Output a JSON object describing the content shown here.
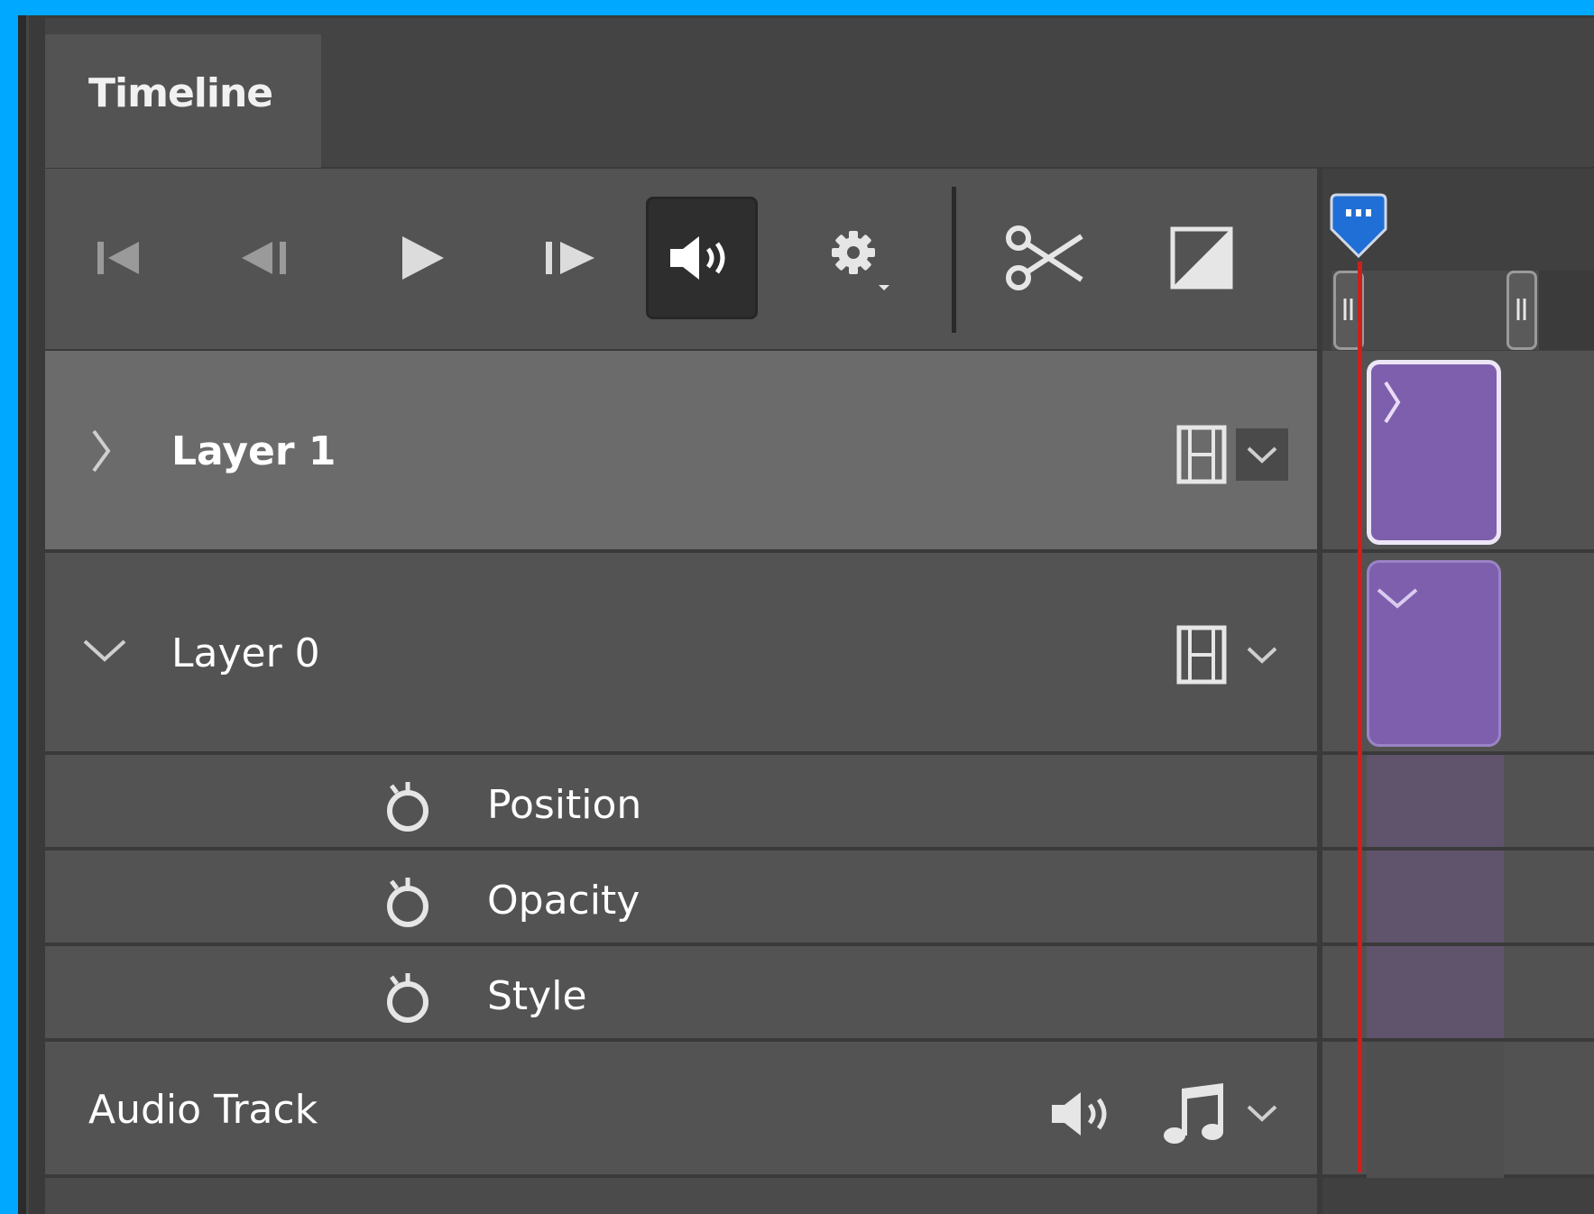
{
  "panel": {
    "tab_label": "Timeline",
    "accent_color": "#1f6fd6",
    "clip_color": "#7e5fad",
    "playhead_color": "#cc2020"
  },
  "toolbar": {
    "buttons": [
      {
        "name": "go-to-first-frame",
        "icon": "skip-start-icon"
      },
      {
        "name": "go-to-previous-frame",
        "icon": "step-back-icon"
      },
      {
        "name": "play",
        "icon": "play-icon"
      },
      {
        "name": "go-to-next-frame",
        "icon": "step-forward-icon"
      },
      {
        "name": "audio-toggle",
        "icon": "speaker-icon",
        "active": true
      },
      {
        "name": "settings",
        "icon": "gear-icon"
      },
      {
        "name": "split-at-playhead",
        "icon": "scissors-icon"
      },
      {
        "name": "transition",
        "icon": "transition-icon"
      }
    ]
  },
  "layers": [
    {
      "label": "Layer 1",
      "expanded": false,
      "selected": true,
      "icon": "film-strip-icon"
    },
    {
      "label": "Layer 0",
      "expanded": true,
      "selected": false,
      "icon": "film-strip-icon",
      "properties": [
        {
          "label": "Position",
          "icon": "stopwatch-icon"
        },
        {
          "label": "Opacity",
          "icon": "stopwatch-icon"
        },
        {
          "label": "Style",
          "icon": "stopwatch-icon"
        }
      ]
    }
  ],
  "audio_track": {
    "label": "Audio Track",
    "icons": [
      "speaker-icon",
      "music-note-icon",
      "chevron-down-icon"
    ]
  }
}
